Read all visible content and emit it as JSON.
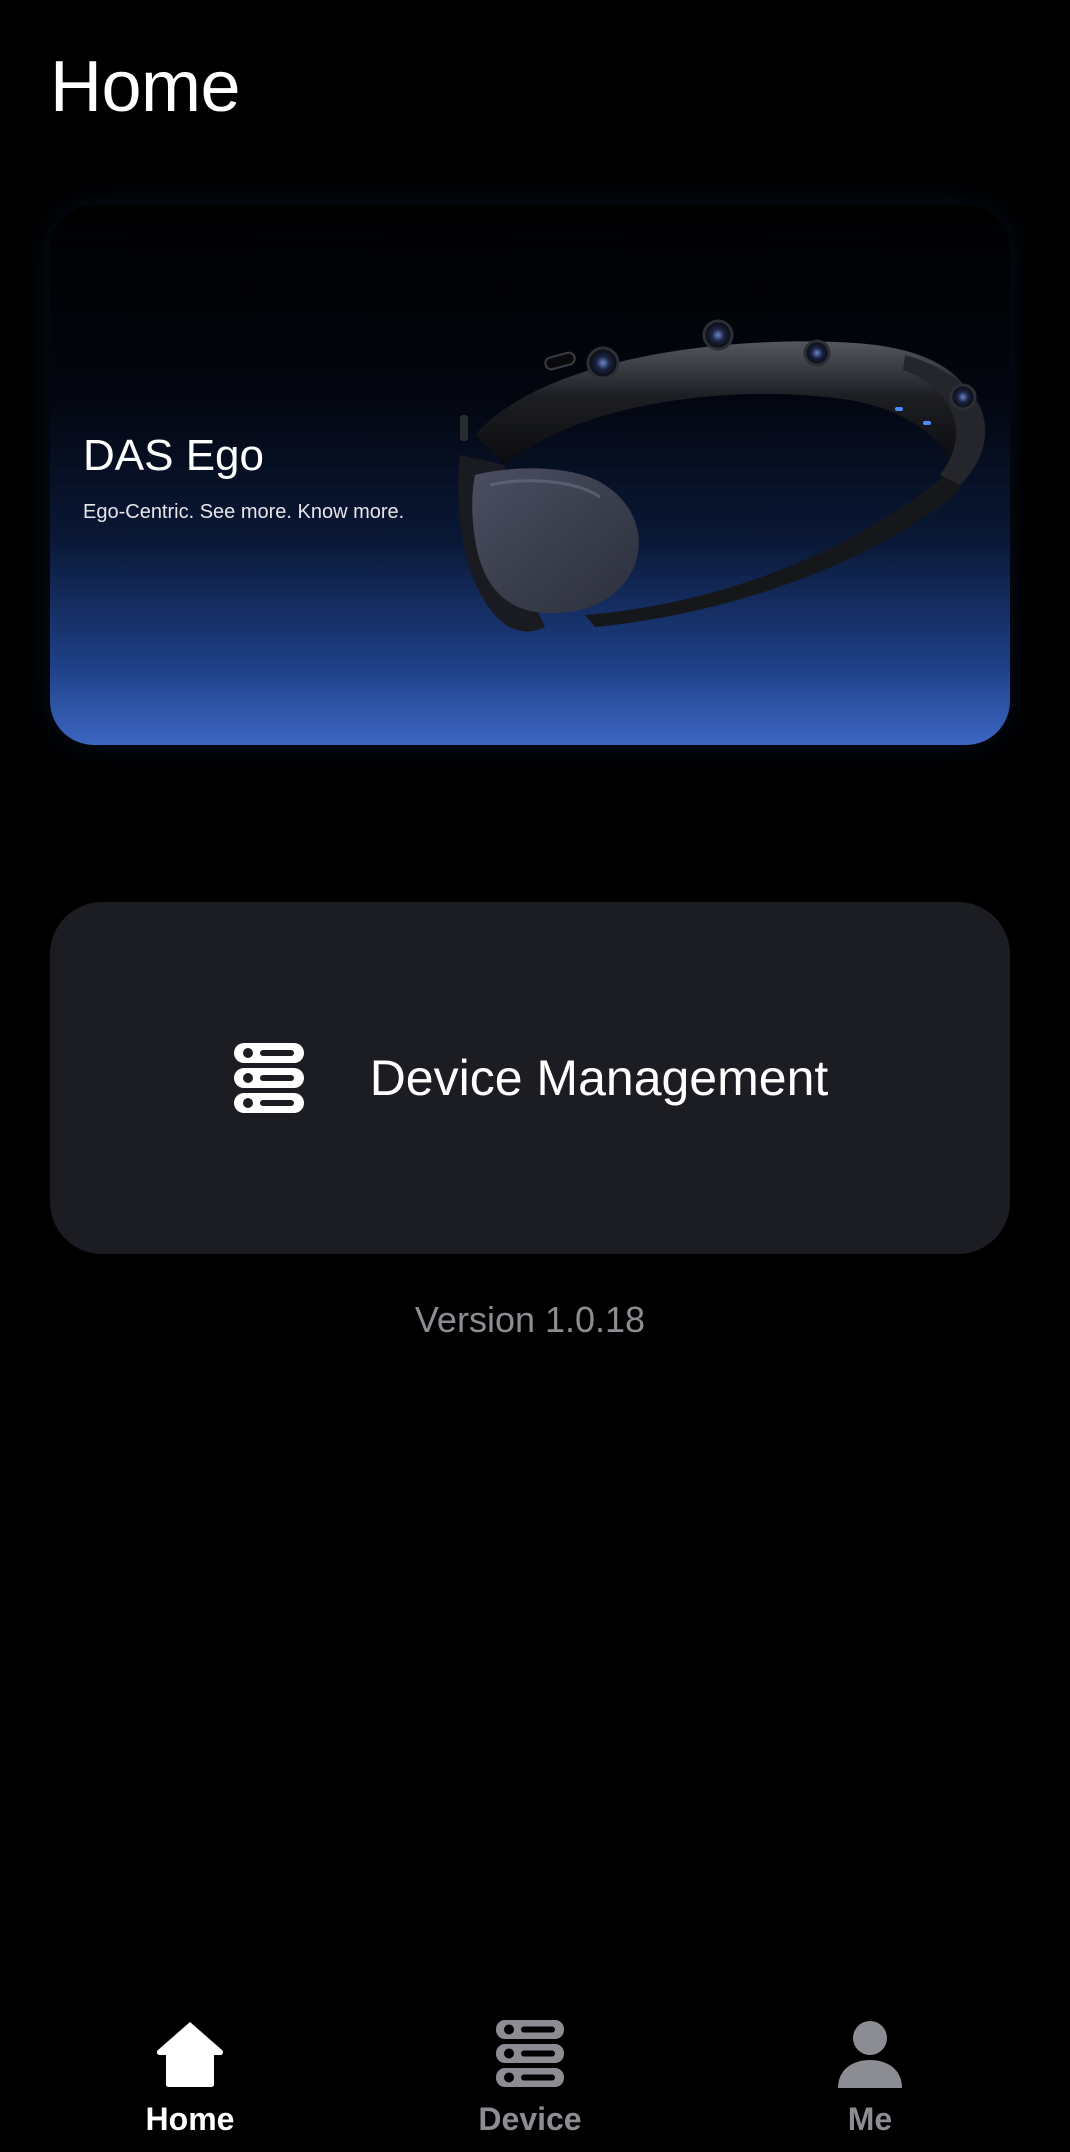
{
  "header": {
    "title": "Home"
  },
  "hero": {
    "title": "DAS Ego",
    "subtitle": "Ego-Centric. See more. Know more.",
    "image_icon": "headset-device-image"
  },
  "device_card": {
    "label": "Device Management",
    "icon": "server-stack-icon"
  },
  "footer": {
    "version": "Version 1.0.18"
  },
  "tabbar": {
    "items": [
      {
        "label": "Home",
        "icon": "home-icon",
        "active": true
      },
      {
        "label": "Device",
        "icon": "server-stack-icon",
        "active": false
      },
      {
        "label": "Me",
        "icon": "person-icon",
        "active": false
      }
    ]
  },
  "colors": {
    "background": "#000000",
    "card": "#1c1d22",
    "muted_text": "#8c8d93",
    "accent_blue": "#3c66c2"
  }
}
